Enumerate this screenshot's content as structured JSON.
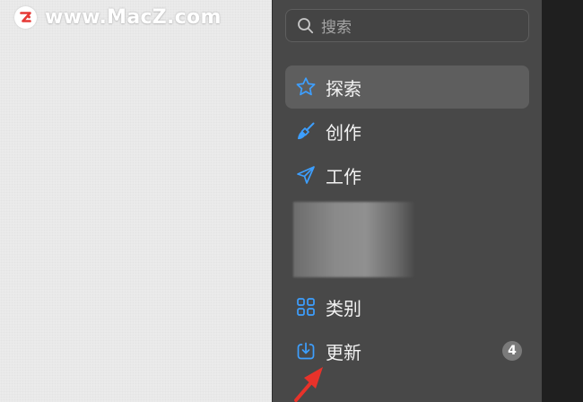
{
  "watermark": {
    "logo_letter": "Z",
    "text": "www.MacZ.com"
  },
  "search": {
    "placeholder": "搜索"
  },
  "sidebar": {
    "items": [
      {
        "label": "探索",
        "icon": "star-icon",
        "active": true
      },
      {
        "label": "创作",
        "icon": "brush-icon"
      },
      {
        "label": "工作",
        "icon": "paper-plane-icon"
      },
      {
        "label": "类别",
        "icon": "grid-icon"
      },
      {
        "label": "更新",
        "icon": "download-icon",
        "badge": "4"
      }
    ]
  },
  "colors": {
    "accent": "#3d9fff",
    "sidebar_bg": "#484848",
    "active_bg": "#5e5e5e",
    "arrow": "#e8322a",
    "watermark_logo": "#e53935"
  }
}
